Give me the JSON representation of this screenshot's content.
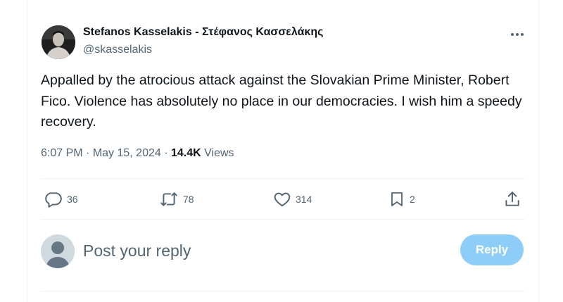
{
  "author": {
    "name": "Stefanos Kasselakis - Στέφανος Κασσελάκης",
    "handle": "@skasselakis"
  },
  "tweet": {
    "text": "Appalled by the atrocious attack against the Slovakian Prime Minister, Robert Fico. Violence has absolutely no place in our democracies. I wish him a speedy recovery.",
    "time": "6:07 PM",
    "date": "May 15, 2024",
    "separator": " · ",
    "views_count": "14.4K",
    "views_label": " Views"
  },
  "actions": {
    "replies": "36",
    "reposts": "78",
    "likes": "314",
    "bookmarks": "2"
  },
  "reply": {
    "placeholder": "Post your reply",
    "button_label": "Reply"
  },
  "colors": {
    "text": "#0f1419",
    "muted": "#536471",
    "reply_button": "#8ecdf8",
    "border": "#eff3f4"
  },
  "icons": [
    "more-icon",
    "reply-icon",
    "repost-icon",
    "like-icon",
    "bookmark-icon",
    "share-icon",
    "avatar-placeholder-icon"
  ]
}
